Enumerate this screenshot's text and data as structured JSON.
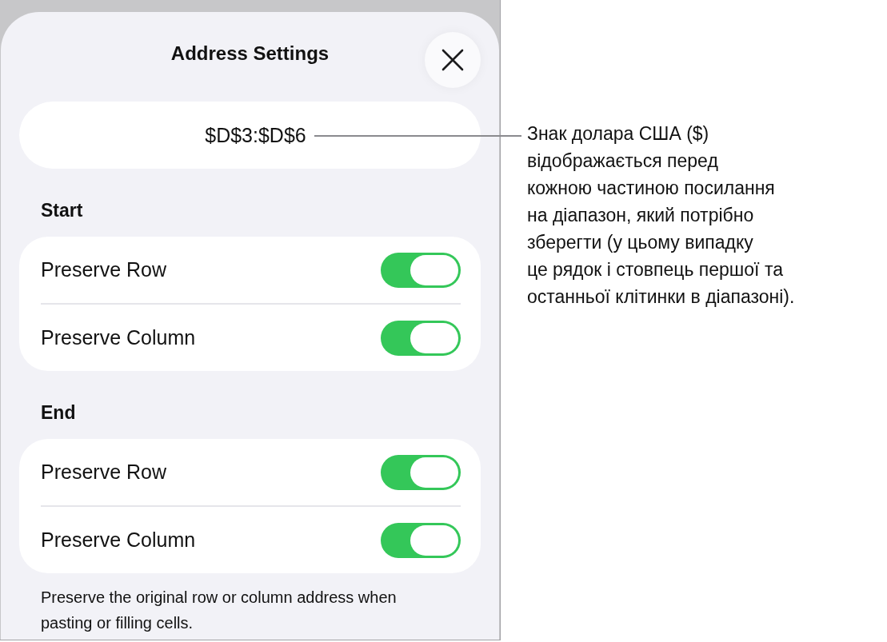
{
  "sheet": {
    "title": "Address Settings"
  },
  "address": {
    "value": "$D$3:$D$6"
  },
  "sections": [
    {
      "header": "Start",
      "rows": [
        {
          "label": "Preserve Row",
          "on": true
        },
        {
          "label": "Preserve Column",
          "on": true
        }
      ]
    },
    {
      "header": "End",
      "rows": [
        {
          "label": "Preserve Row",
          "on": true
        },
        {
          "label": "Preserve Column",
          "on": true
        }
      ]
    }
  ],
  "footer": "Preserve the original row or column address when pasting or filling cells.",
  "callout": {
    "text": "Знак долара США ($)\nвідображається перед\nкожною частиною посилання\nна діапазон, який потрібно\nзберегти (у цьому випадку\nце рядок і стовпець першої та\nостанньої клітинки в діапазоні)."
  }
}
